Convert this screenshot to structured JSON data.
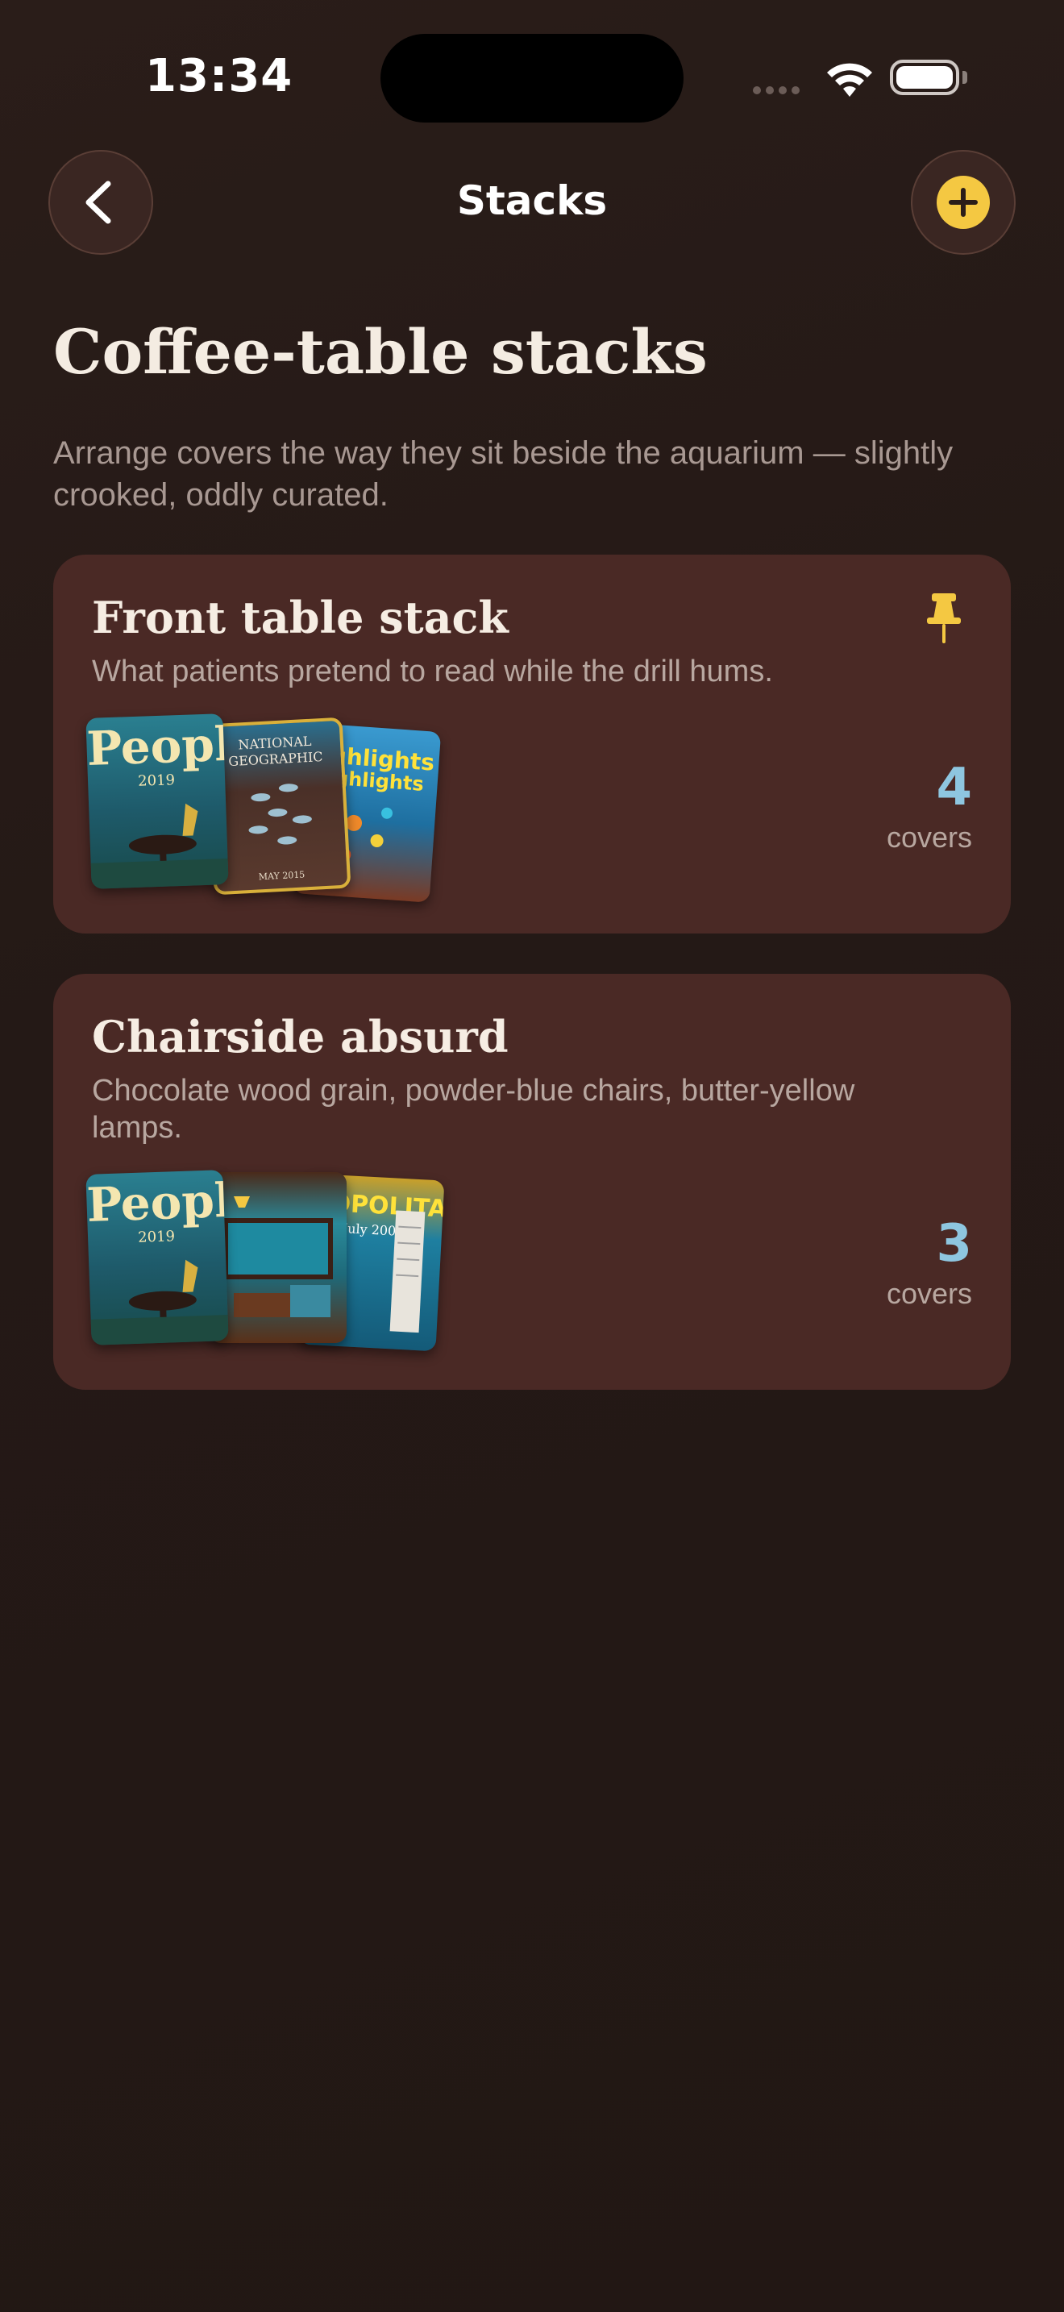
{
  "status": {
    "time": "13:34"
  },
  "nav": {
    "title": "Stacks",
    "back_icon": "chevron-left-icon",
    "add_icon": "plus-circle-icon",
    "accent": "#f4c842"
  },
  "header": {
    "title": "Coffee-table stacks",
    "subtitle": "Arrange covers the way they sit beside the aquarium — slightly crooked, oddly curated."
  },
  "stacks": [
    {
      "title": "Front table stack",
      "description": "What patients pretend to read while the drill hums.",
      "pinned": true,
      "count": "4",
      "count_label": "covers",
      "covers": [
        {
          "masthead": "People",
          "sub": "2019"
        },
        {
          "masthead": "NATIONAL GEOGRAPHIC",
          "sub": "MAY 2015"
        },
        {
          "masthead": "highlights",
          "sub": "highlights"
        }
      ]
    },
    {
      "title": "Chairside absurd",
      "description": "Chocolate wood grain, powder-blue chairs, butter-yellow lamps.",
      "pinned": false,
      "count": "3",
      "count_label": "covers",
      "covers": [
        {
          "masthead": "People",
          "sub": "2019"
        },
        {
          "masthead": "",
          "sub": ""
        },
        {
          "masthead": "MOPOLITA",
          "sub": "July 2008"
        }
      ]
    }
  ]
}
